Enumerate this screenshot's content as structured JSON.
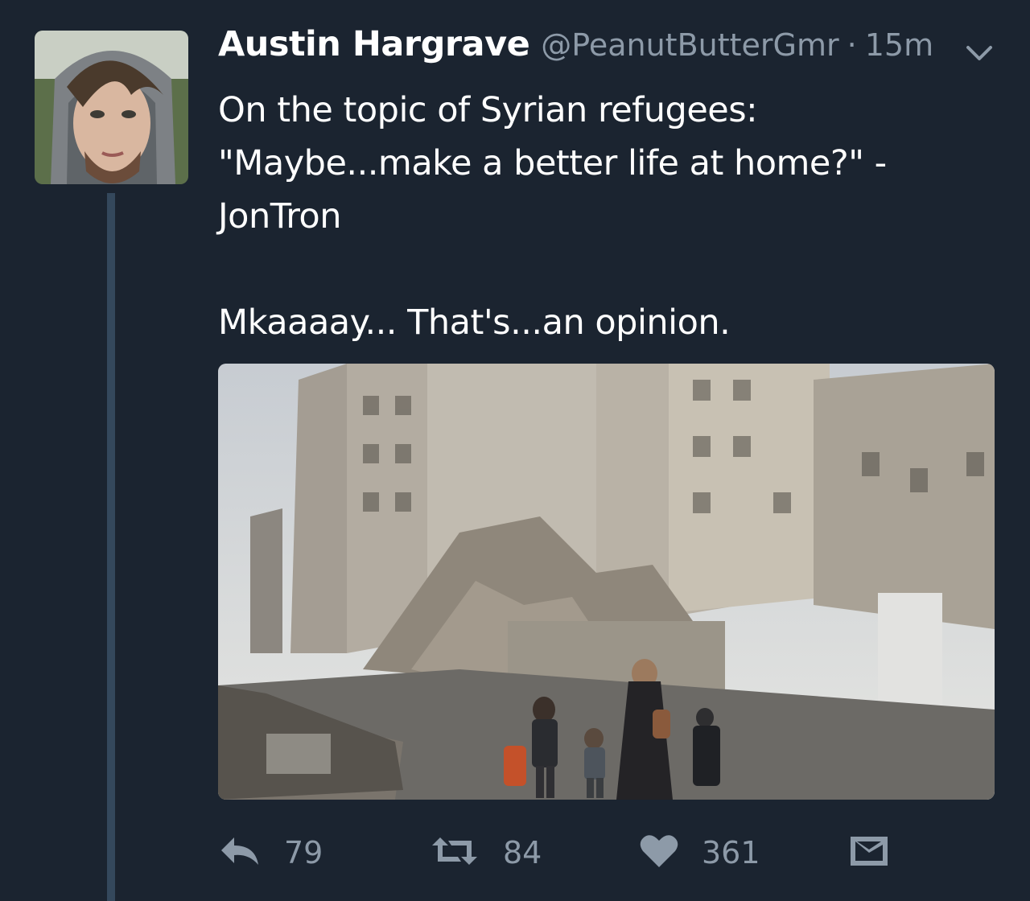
{
  "tweet": {
    "author_name": "Austin Hargrave",
    "handle": "@PeanutButterGmr",
    "separator": "·",
    "time": "15m",
    "text_lines": [
      "On the topic of Syrian refugees:",
      "\"Maybe...make a better life at home?\" -",
      "JonTron"
    ],
    "text_line_2": "Mkaaaay... That's...an opinion.",
    "media_description": "photo"
  },
  "actions": {
    "reply_count": "79",
    "retweet_count": "84",
    "like_count": "361"
  },
  "icons": {
    "caret": "chevron-down-icon",
    "reply": "reply-icon",
    "retweet": "retweet-icon",
    "like": "heart-icon",
    "dm": "envelope-icon"
  },
  "colors": {
    "background": "#1b2430",
    "text": "#ffffff",
    "muted": "#8d9aa8",
    "thread_line": "#34485c"
  }
}
